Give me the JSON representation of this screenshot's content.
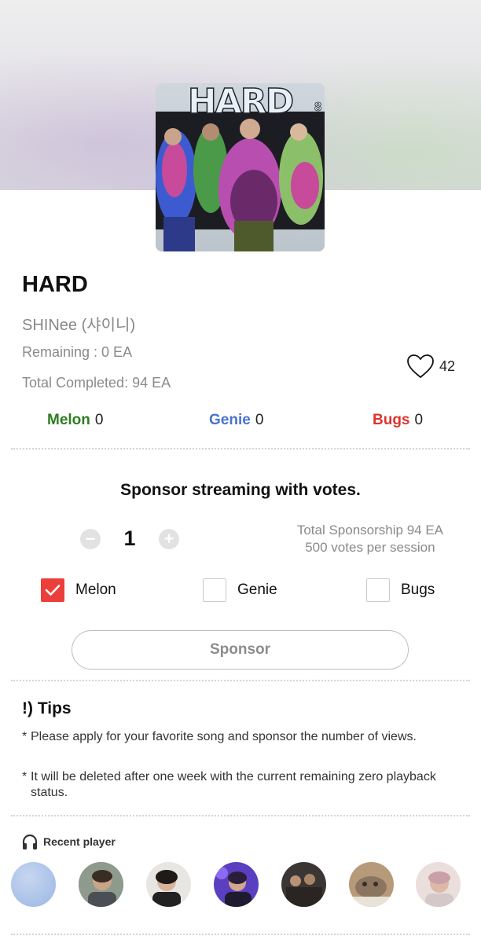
{
  "song": {
    "cover_title": "HARD",
    "cover_subtitle": "8",
    "title": "HARD",
    "artist": "SHINee (샤이니)",
    "remaining": "Remaining : 0 EA",
    "total_completed": "Total Completed: 94 EA",
    "likes": "42"
  },
  "platforms": [
    {
      "name": "Melon",
      "count": "0",
      "color": "#2e7d22"
    },
    {
      "name": "Genie",
      "count": "0",
      "color": "#4a72d0"
    },
    {
      "name": "Bugs",
      "count": "0",
      "color": "#e0322c"
    }
  ],
  "sponsor": {
    "heading": "Sponsor streaming with votes.",
    "minus_glyph": "−",
    "plus_glyph": "+",
    "quantity": "1",
    "total_sponsorship": "Total Sponsorship 94 EA",
    "votes_per_session": "500 votes per session",
    "options": [
      {
        "label": "Melon",
        "checked": true
      },
      {
        "label": "Genie",
        "checked": false
      },
      {
        "label": "Bugs",
        "checked": false
      }
    ],
    "button_label": "Sponsor"
  },
  "tips": {
    "title": "!) Tips",
    "marker": "*",
    "items": [
      "Please apply for your favorite song and sponsor the number of views.",
      "It will be deleted after one week with the current remaining zero playback status."
    ]
  },
  "recent": {
    "label": "Recent player",
    "icon": "headphones-icon",
    "avatars": [
      "avatar-1",
      "avatar-2",
      "avatar-3",
      "avatar-4",
      "avatar-5",
      "avatar-6",
      "avatar-7"
    ]
  },
  "colors": {
    "accent_red": "#ec3f3b",
    "melon_green": "#2e7d22",
    "genie_blue": "#4a72d0",
    "bugs_red": "#e0322c"
  }
}
